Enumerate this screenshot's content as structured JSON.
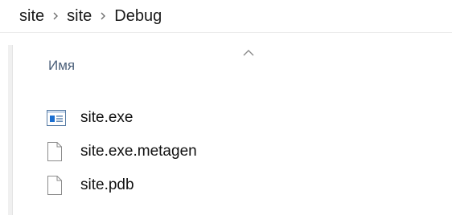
{
  "breadcrumb": {
    "items": [
      "site",
      "site",
      "Debug"
    ]
  },
  "columns": {
    "name_header": "Имя",
    "sort": "ascending"
  },
  "files": [
    {
      "name": "site.exe",
      "icon": "exe-icon"
    },
    {
      "name": "site.exe.metagen",
      "icon": "file-icon"
    },
    {
      "name": "site.pdb",
      "icon": "file-icon"
    }
  ],
  "colors": {
    "header_text": "#4c607a",
    "exe_icon_blue": "#1b6fd1"
  }
}
